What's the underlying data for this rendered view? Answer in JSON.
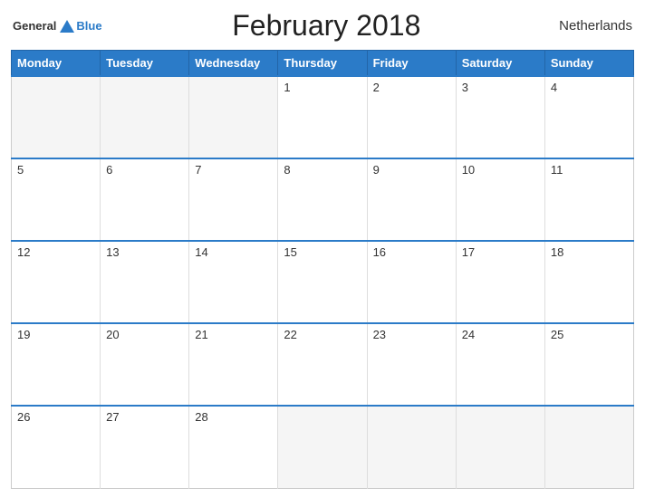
{
  "header": {
    "logo_general": "General",
    "logo_blue": "Blue",
    "title": "February 2018",
    "country": "Netherlands"
  },
  "calendar": {
    "weekdays": [
      "Monday",
      "Tuesday",
      "Wednesday",
      "Thursday",
      "Friday",
      "Saturday",
      "Sunday"
    ],
    "weeks": [
      [
        null,
        null,
        null,
        1,
        2,
        3,
        4
      ],
      [
        5,
        6,
        7,
        8,
        9,
        10,
        11
      ],
      [
        12,
        13,
        14,
        15,
        16,
        17,
        18
      ],
      [
        19,
        20,
        21,
        22,
        23,
        24,
        25
      ],
      [
        26,
        27,
        28,
        null,
        null,
        null,
        null
      ]
    ]
  }
}
